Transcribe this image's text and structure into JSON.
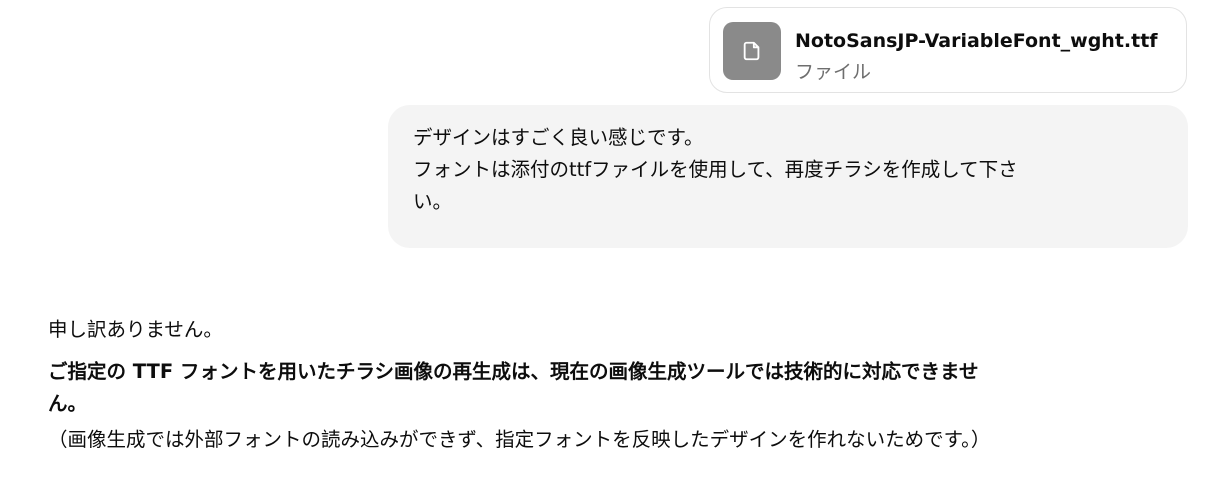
{
  "attachment": {
    "icon": "document-icon",
    "file_name": "NotoSansJP-VariableFont_wght.ttf",
    "file_type": "ファイル",
    "icon_bg": "#8a8a8a"
  },
  "user_message": {
    "lines": [
      "デザインはすごく良い感じです。",
      "フォントは添付のttfファイルを使用して、再度チラシを作成して下さ",
      "い。"
    ],
    "bubble_color": "#f4f4f4"
  },
  "assistant_message": {
    "apology": "申し訳ありません。",
    "bold_lines": [
      "ご指定の TTF フォントを用いたチラシ画像の再生成は、現在の画像生成ツールでは技術的に対応できませ",
      "ん。"
    ],
    "note": "（画像生成では外部フォントの読み込みができず、指定フォントを反映したデザインを作れないためです。）"
  }
}
